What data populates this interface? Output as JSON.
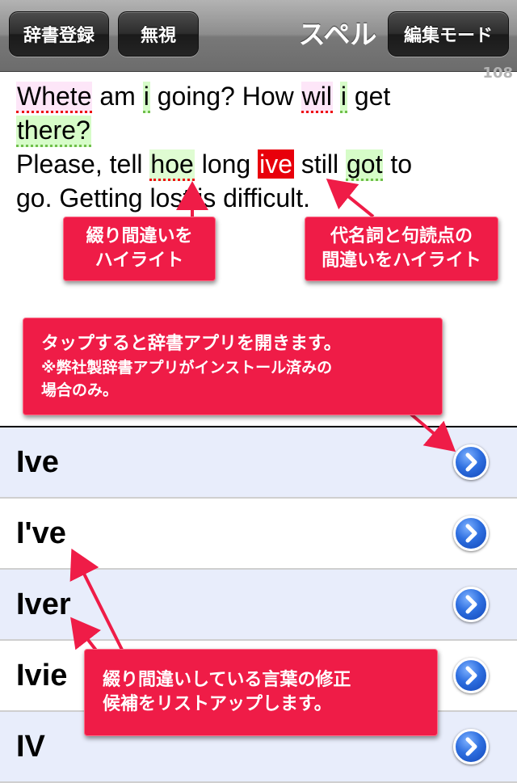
{
  "toolbar": {
    "dictionary_register_label": "辞書登録",
    "ignore_label": "無視",
    "title": "スペル",
    "edit_mode_label": "編集モード"
  },
  "char_count": "108",
  "text": {
    "line1": {
      "w1": "Whete",
      "w2": " am ",
      "w3": "i",
      "w4": " going? How ",
      "w5": "wil",
      "w6": " ",
      "w7": "i",
      "w8": " get"
    },
    "line2": {
      "w1": "there?"
    },
    "line3": {
      "w1": "Please, tell ",
      "w2": "hoe",
      "w3": " long ",
      "w4": "ive",
      "w5": " still ",
      "w6": "got",
      "w7": " to"
    },
    "line4": {
      "w1": "go. Getting lost is difficult."
    }
  },
  "callouts": {
    "spelling": {
      "line1": "綴り間違いを",
      "line2": "ハイライト"
    },
    "grammar": {
      "line1": "代名詞と句読点の",
      "line2": "間違いをハイライト"
    },
    "dictionary": {
      "line1": "タップすると辞書アプリを開きます。",
      "line2": "※弊社製辞書アプリがインストール済みの",
      "line3": "場合のみ。"
    },
    "suggestions": {
      "line1": "綴り間違いしている言葉の修正",
      "line2": "候補をリストアップします。"
    }
  },
  "suggestions": [
    "Ive",
    "I've",
    "Iver",
    "Ivie",
    "IV"
  ],
  "colors": {
    "callout": "#ef1c47",
    "selected_error": "#e8000b",
    "spelling_highlight": "#fde6f8",
    "grammar_highlight": "#d6fcc8",
    "disclosure": "#2e6fe0"
  },
  "icons": {
    "row_action": "disclosure-chevron-icon"
  }
}
